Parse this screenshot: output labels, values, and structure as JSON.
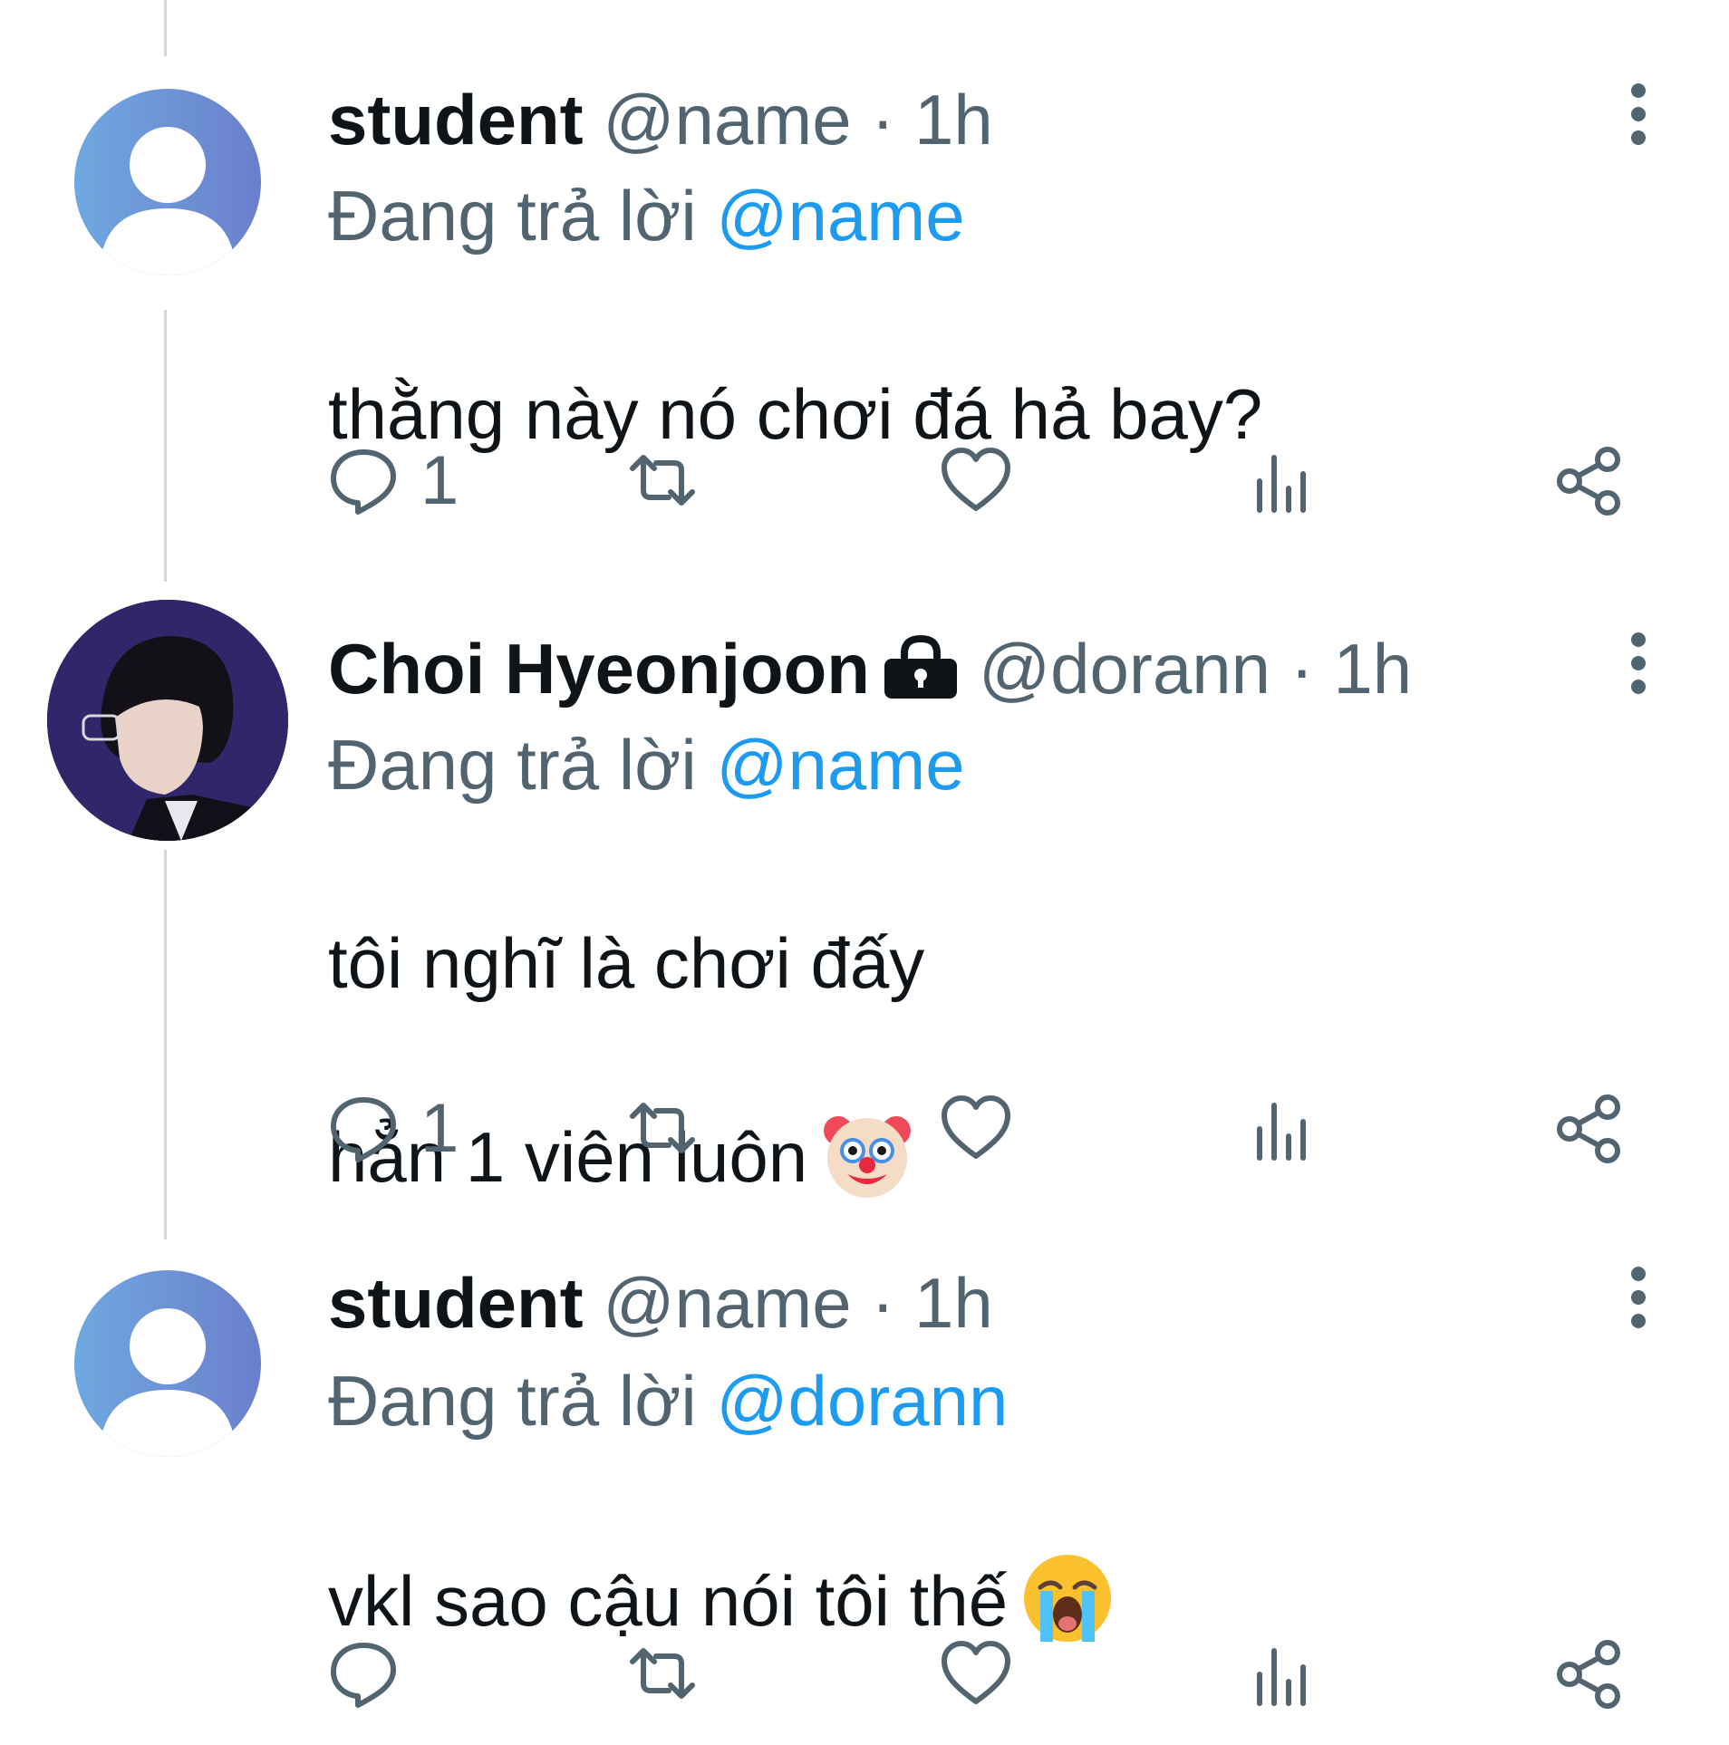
{
  "tweets": [
    {
      "display_name": "student",
      "handle": "@name",
      "separator": "·",
      "time": "1h",
      "reply_prefix": "Đang trả lời",
      "reply_to": "@name",
      "text": "thằng này nó chơi đá hả bay?",
      "avatar": "default-avatar",
      "actions": {
        "reply_count": "1"
      }
    },
    {
      "display_name": "Choi Hyeonjoon",
      "handle": "@dorann",
      "separator": "·",
      "time": "1h",
      "reply_prefix": "Đang trả lời",
      "reply_to": "@name",
      "text_line1": "tôi nghĩ là chơi đấy",
      "text_line2": "hẳn 1 viên luôn",
      "avatar": "photo-avatar",
      "protected_icon": "lock-icon",
      "emoji": "clown-face-emoji",
      "actions": {
        "reply_count": "1"
      }
    },
    {
      "display_name": "student",
      "handle": "@name",
      "separator": "·",
      "time": "1h",
      "reply_prefix": "Đang trả lời",
      "reply_to": "@dorann",
      "text": "vkl sao cậu nói tôi thế",
      "avatar": "default-avatar",
      "emoji": "loudly-crying-face-emoji",
      "actions": {
        "reply_count": ""
      }
    }
  ],
  "icons": {
    "reply": "reply-icon",
    "retweet": "retweet-icon",
    "like": "like-icon",
    "views": "views-icon",
    "share": "share-icon",
    "more": "more-icon"
  },
  "colors": {
    "accent": "#1d9bf0",
    "secondary_text": "#536471",
    "primary_text": "#0f1419",
    "thread_line": "#cfd9de"
  }
}
